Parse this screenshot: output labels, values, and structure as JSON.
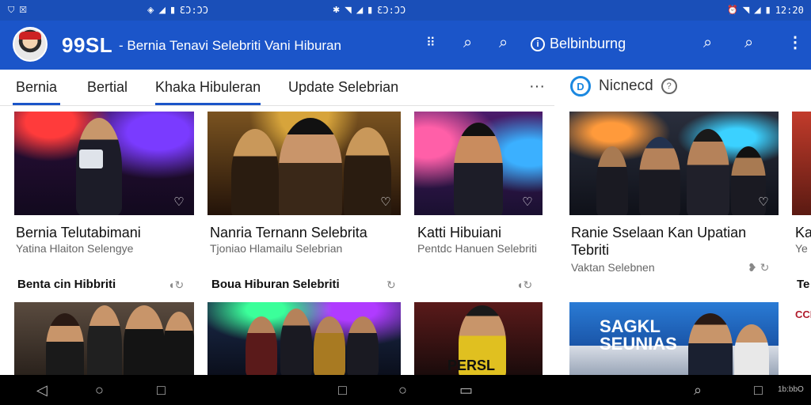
{
  "status_bar": {
    "left_icons": [
      "shield-icon",
      "close-box-icon"
    ],
    "seg1": {
      "time": "ƐƆ:ƆƆ"
    },
    "seg2": {
      "time": "ƐƆ:ƆƆ"
    },
    "seg3": {
      "time": "12:20"
    }
  },
  "app_bar": {
    "brand": "99SL",
    "tagline": "- Bernia Tenavi Selebriti Vani Hiburan",
    "subscribe_label": "Belbinburng"
  },
  "tabs": [
    {
      "label": "Bernia"
    },
    {
      "label": "Bertial"
    },
    {
      "label": "Khaka Hibuleran"
    },
    {
      "label": "Update Selebrian"
    }
  ],
  "right_panel": {
    "badge": "D",
    "title": "Nicnecd",
    "help": "?"
  },
  "cards_row1": [
    {
      "title": "Bernia Telutabimani",
      "subtitle": "Yatina Hlaiton Selengye"
    },
    {
      "title": "Nanria Ternann Selebrita",
      "subtitle": "Tjoniao Hlamailu Selebrian"
    },
    {
      "title": "Katti Hibuiani",
      "subtitle": "Pentdc Hanuen Selebriti"
    },
    {
      "title": "Ranie Sselaan Kan Upatian Tebriti",
      "subtitle": "Vaktan Selebnen"
    },
    {
      "title": "Ka",
      "subtitle": "Ye"
    }
  ],
  "section_heads": [
    {
      "label": "Benta cin Hibbriti"
    },
    {
      "label": "Boua Hiburan Selebriti"
    },
    {
      "label": "Te"
    }
  ],
  "cards_row2": [
    {
      "caption": ""
    },
    {
      "caption": ""
    },
    {
      "caption": "PERSL"
    },
    {
      "caption": "SAGKL SEUNIAS"
    },
    {
      "caption": "CCI"
    }
  ],
  "nav": {
    "right_text": "1b:bbO"
  },
  "colors": {
    "primary": "#1b55c9",
    "status_bar": "#1a4fb8",
    "nav_bar": "#000000"
  }
}
